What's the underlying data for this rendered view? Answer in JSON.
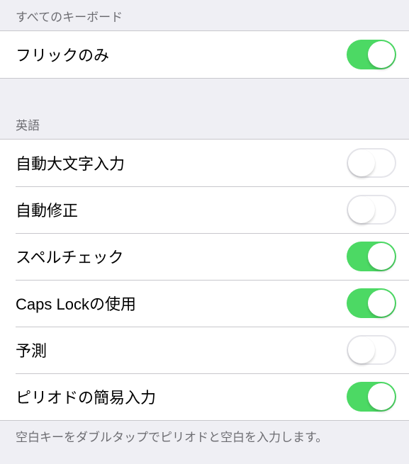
{
  "sections": {
    "all_keyboards": {
      "header": "すべてのキーボード",
      "rows": [
        {
          "label": "フリックのみ",
          "on": true
        }
      ]
    },
    "english": {
      "header": "英語",
      "rows": [
        {
          "label": "自動大文字入力",
          "on": false
        },
        {
          "label": "自動修正",
          "on": false
        },
        {
          "label": "スペルチェック",
          "on": true
        },
        {
          "label": "Caps Lockの使用",
          "on": true
        },
        {
          "label": "予測",
          "on": false
        },
        {
          "label": "ピリオドの簡易入力",
          "on": true
        }
      ],
      "footer": "空白キーをダブルタップでピリオドと空白を入力します。"
    }
  }
}
